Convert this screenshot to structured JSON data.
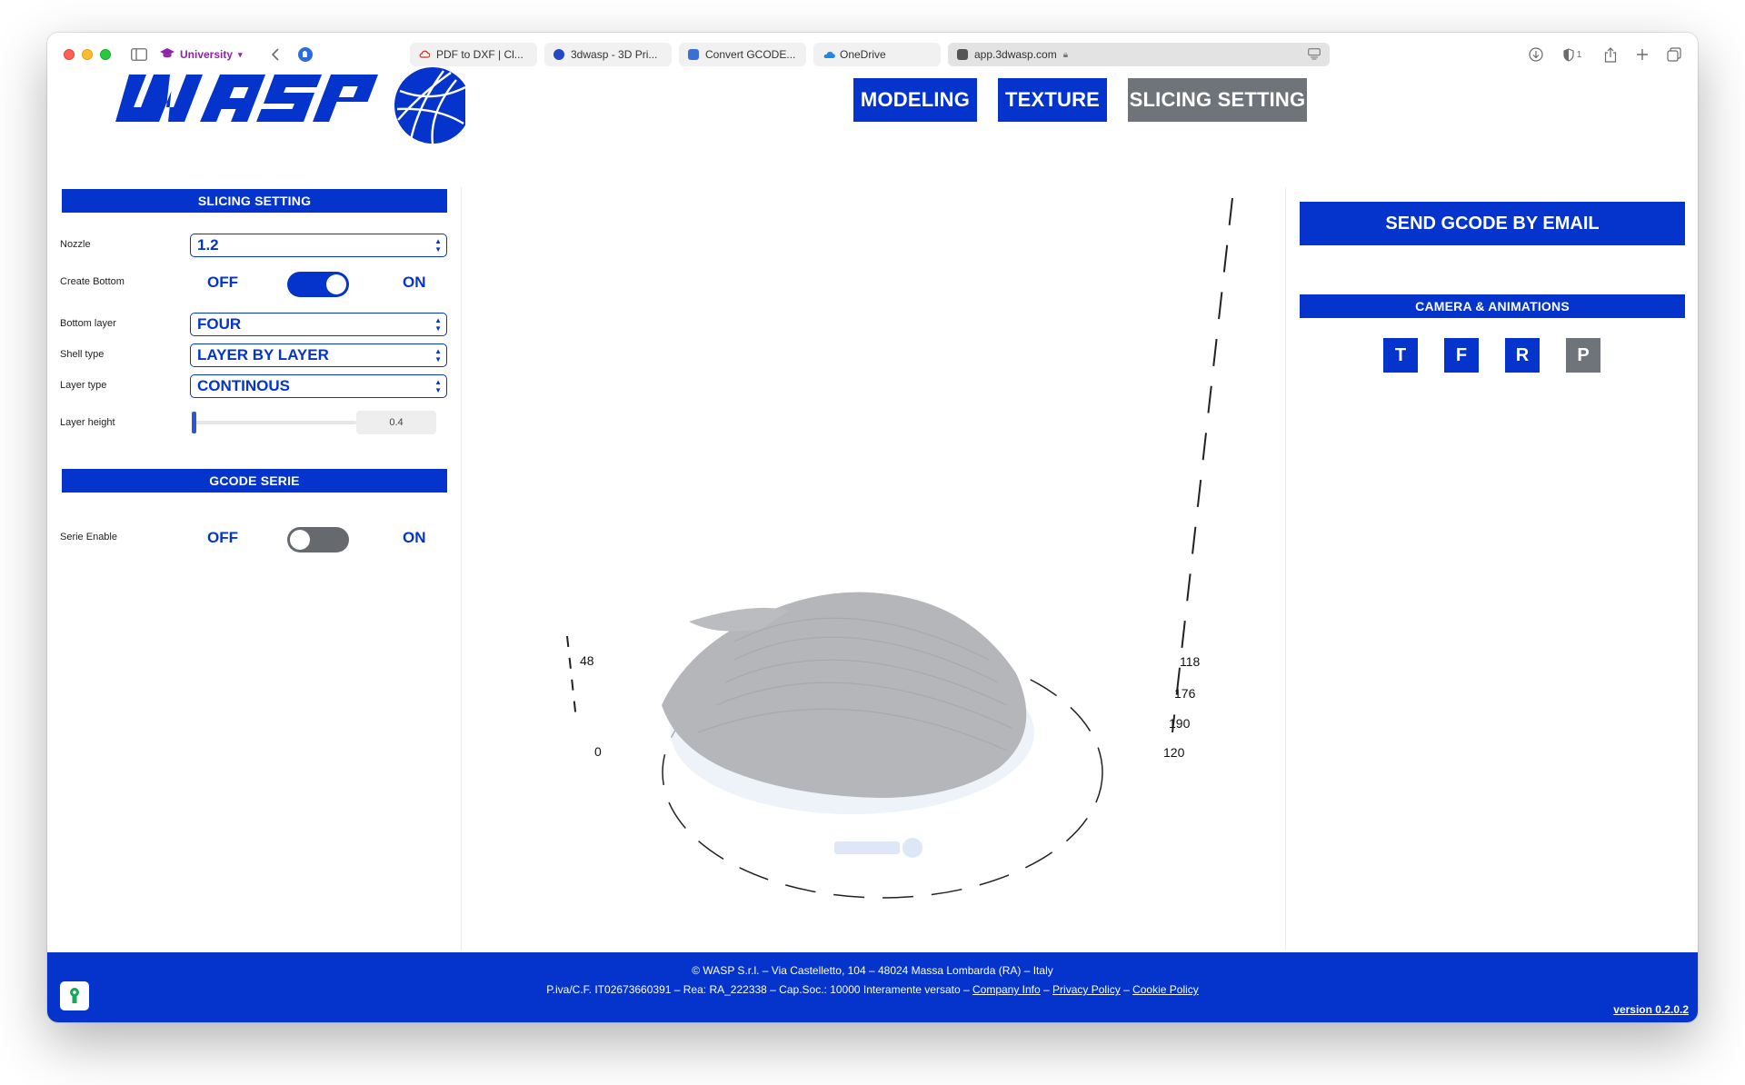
{
  "browser": {
    "profile_label": "University",
    "tabs": [
      {
        "label": "PDF to DXF | Cl...",
        "favicon_color": "#c0392b"
      },
      {
        "label": "3dwasp - 3D Pri...",
        "favicon_color": "#2446c8"
      },
      {
        "label": "Convert GCODE...",
        "favicon_color": "#3b6fd6"
      },
      {
        "label": "OneDrive",
        "favicon_color": "#1e88e5"
      }
    ],
    "address": "app.3dwasp.com",
    "toolbar_icons": [
      "sidebar-icon",
      "back-icon",
      "extension-icon",
      "download-icon",
      "privacy-shield-icon",
      "share-icon",
      "new-tab-icon",
      "tab-overview-icon"
    ],
    "shield_count": "1"
  },
  "header": {
    "modes": [
      {
        "label": "MODELING",
        "active": false
      },
      {
        "label": "TEXTURE",
        "active": false
      },
      {
        "label": "SLICING SETTING",
        "active": true
      }
    ]
  },
  "slicing": {
    "section_title": "SLICING SETTING",
    "nozzle": {
      "label": "Nozzle",
      "value": "1.2"
    },
    "create_bottom": {
      "label": "Create Bottom",
      "off": "OFF",
      "on": "ON",
      "enabled": true
    },
    "bottom_layer": {
      "label": "Bottom layer",
      "value": "FOUR"
    },
    "shell_type": {
      "label": "Shell type",
      "value": "LAYER BY LAYER"
    },
    "layer_type": {
      "label": "Layer type",
      "value": "CONTINOUS"
    },
    "layer_height": {
      "label": "Layer height",
      "value": "0.4",
      "position": 0.0
    }
  },
  "gcode_serie": {
    "section_title": "GCODE SERIE",
    "serie_enable": {
      "label": "Serie Enable",
      "off": "OFF",
      "on": "ON",
      "enabled": false
    }
  },
  "viewport": {
    "labels_left": [
      "48",
      "0"
    ],
    "labels_right": [
      "118",
      "176",
      "190",
      "120"
    ]
  },
  "right_panel": {
    "send_label": "SEND GCODE BY EMAIL",
    "camera_title": "CAMERA & ANIMATIONS",
    "camera_buttons": [
      {
        "label": "T",
        "active": false
      },
      {
        "label": "F",
        "active": false
      },
      {
        "label": "R",
        "active": false
      },
      {
        "label": "P",
        "active": true
      }
    ]
  },
  "footer": {
    "line1": "© WASP S.r.l. –  Via Castelletto, 104  –  48024 Massa Lombarda (RA) – Italy",
    "line2_text": "P.iva/C.F. IT02673660391 – Rea: RA_222338 – Cap.Soc.: 10000 Interamente versato – ",
    "company_info": "Company Info",
    "privacy_policy": "Privacy Policy",
    "cookie_policy": "Cookie Policy",
    "sep": " – ",
    "version": "version 0.2.0.2"
  },
  "colors": {
    "brand_blue": "#0434cc",
    "inactive_grey": "#6f747a"
  }
}
